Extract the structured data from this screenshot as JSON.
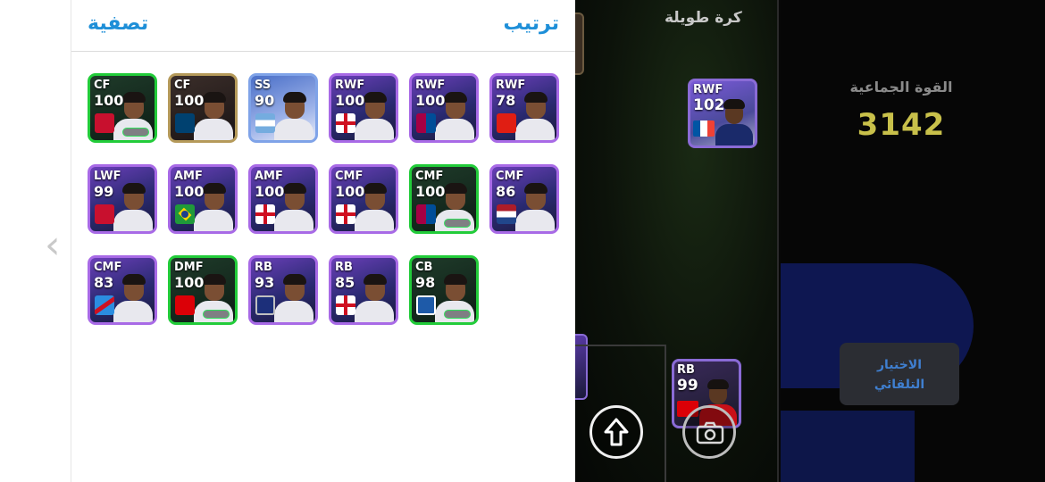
{
  "panel": {
    "filter_label": "تصفية",
    "sort_label": "ترتيب"
  },
  "players": [
    {
      "pos": "CF",
      "rating": "100",
      "badge": "club-acm",
      "style": "green"
    },
    {
      "pos": "CF",
      "rating": "100",
      "badge": "club-psg",
      "style": "gold"
    },
    {
      "pos": "SS",
      "rating": "90",
      "badge": "flag-arg",
      "style": "blue"
    },
    {
      "pos": "RWF",
      "rating": "100",
      "badge": "flag-eng",
      "style": "purple"
    },
    {
      "pos": "RWF",
      "rating": "100",
      "badge": "club-fcb",
      "style": "purple"
    },
    {
      "pos": "RWF",
      "rating": "78",
      "badge": "club-losc",
      "style": "purple"
    },
    {
      "pos": "LWF",
      "rating": "99",
      "badge": "club-acm",
      "style": "purple"
    },
    {
      "pos": "AMF",
      "rating": "100",
      "badge": "flag-bra",
      "style": "purple"
    },
    {
      "pos": "AMF",
      "rating": "100",
      "badge": "flag-eng",
      "style": "purple"
    },
    {
      "pos": "CMF",
      "rating": "100",
      "badge": "flag-eng",
      "style": "purple"
    },
    {
      "pos": "CMF",
      "rating": "100",
      "badge": "club-fcb",
      "style": "green"
    },
    {
      "pos": "CMF",
      "rating": "86",
      "badge": "flag-ned",
      "style": "purple"
    },
    {
      "pos": "CMF",
      "rating": "83",
      "badge": "flag-cod",
      "style": "purple"
    },
    {
      "pos": "DMF",
      "rating": "100",
      "badge": "club-ars",
      "style": "green"
    },
    {
      "pos": "RB",
      "rating": "93",
      "badge": "club-zwe",
      "style": "purple"
    },
    {
      "pos": "RB",
      "rating": "85",
      "badge": "flag-eng",
      "style": "purple"
    },
    {
      "pos": "CB",
      "rating": "98",
      "badge": "club-ata",
      "style": "green"
    }
  ],
  "game": {
    "formation_title": "كرة طويلة",
    "team_strength_label": "القوة الجماعية",
    "team_strength_value": "3142",
    "auto_select_line1": "الاختيار",
    "auto_select_line2": "التلقائي",
    "pitch_cards": [
      {
        "pos": "RWF",
        "rating": "102",
        "badge": "flag-fra"
      },
      {
        "pos": "RB",
        "rating": "99",
        "badge": "club-ars"
      }
    ]
  },
  "colors": {
    "accent": "#1e8fd8",
    "strength": "#c8c04a",
    "auto_select_text": "#3f7fd0"
  }
}
